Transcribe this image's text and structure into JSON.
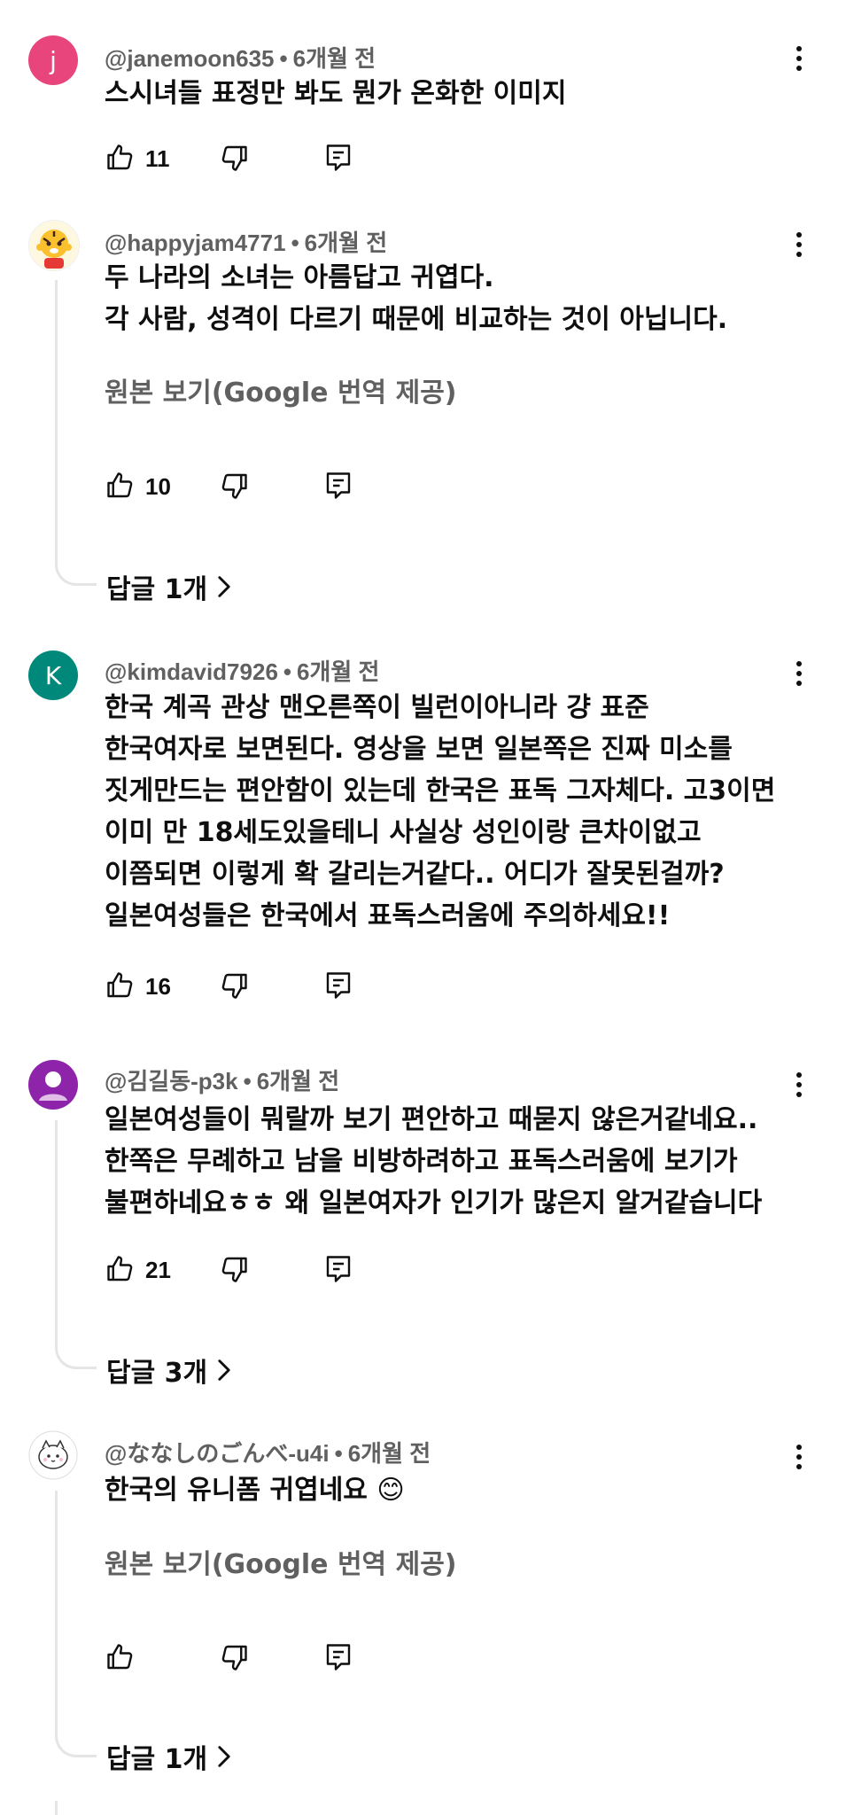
{
  "comments": [
    {
      "avatar_letter": "j",
      "avatar_color": "#e8457c",
      "user": "@janemoon635",
      "time": "6개월 전",
      "text": "스시녀들 표정만 봐도 뭔가 온화한 이미지",
      "likes": "11"
    },
    {
      "avatar_letter": "",
      "avatar_color": "#ffffff",
      "user": "@happyjam4771",
      "time": "6개월 전",
      "text": "두 나라의 소녀는 아름답고 귀엽다.\n각 사람, 성격이 다르기 때문에 비교하는 것이 아닙니다.",
      "translate": "원본 보기(Google 번역 제공)",
      "likes": "10",
      "replies": "답글 1개"
    },
    {
      "avatar_letter": "K",
      "avatar_color": "#00897b",
      "user": "@kimdavid7926",
      "time": "6개월 전",
      "text": "한국 계곡 관상 맨오른쪽이 빌런이아니라 걍 표준\n한국여자로 보면된다. 영상을 보면 일본쪽은 진짜 미소를\n짓게만드는 편안함이 있는데 한국은 표독 그자체다. 고3이면\n이미 만 18세도있을테니 사실상 성인이랑 큰차이없고\n이쯤되면 이렇게 확 갈리는거같다.. 어디가 잘못된걸까?\n일본여성들은 한국에서 표독스러움에 주의하세요!!",
      "likes": "16"
    },
    {
      "avatar_letter": "",
      "avatar_color": "#8e24aa",
      "user": "@김길동-p3k",
      "time": "6개월 전",
      "text": "일본여성들이 뭐랄까 보기 편안하고 때묻지 않은거같네요..\n한쪽은 무례하고 남을 비방하려하고 표독스러움에 보기가\n불편하네요ㅎㅎ 왜 일본여자가 인기가 많은지 알거같습니다",
      "likes": "21",
      "replies": "답글 3개"
    },
    {
      "avatar_letter": "",
      "avatar_color": "#ffffff",
      "user": "@ななしのごんべ-u4i",
      "time": "6개월 전",
      "text": "한국의 유니폼 귀엽네요 😊",
      "translate": "원본 보기(Google 번역 제공)",
      "likes": "",
      "replies": "답글 1개"
    }
  ],
  "icons": [
    "like-icon",
    "dislike-icon",
    "reply-icon",
    "more-vert-icon",
    "chevron-right-icon"
  ]
}
